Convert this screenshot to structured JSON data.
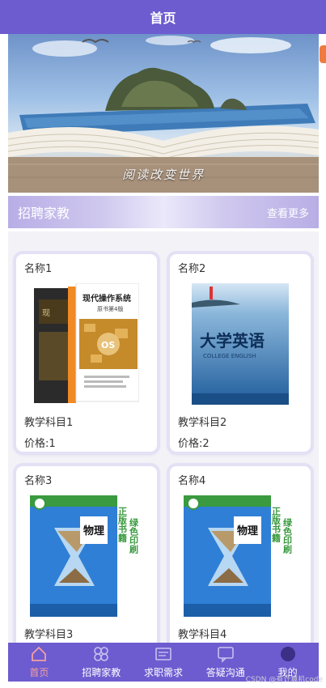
{
  "header": {
    "title": "首页"
  },
  "banner": {
    "slogan": "阅读改变世界"
  },
  "section": {
    "title": "招聘家教",
    "more_label": "查看更多"
  },
  "cards": [
    {
      "name": "名称1",
      "subject": "教学科目1",
      "price": "价格:1",
      "cover": "os-book"
    },
    {
      "name": "名称2",
      "subject": "教学科目2",
      "price": "价格:2",
      "cover": "english-book",
      "cover_title": "大学英语",
      "cover_subtitle": "COLLEGE ENGLISH"
    },
    {
      "name": "名称3",
      "subject": "教学科目3",
      "cover": "physics-book",
      "cover_title": "物理",
      "side_text": "正版书籍 绿色印刷"
    },
    {
      "name": "名称4",
      "subject": "教学科目4",
      "cover": "physics-book",
      "cover_title": "物理",
      "side_text": "正版书籍 绿色印刷"
    }
  ],
  "os_book": {
    "title": "现代操作系统",
    "subtitle": "原书第4版",
    "badge": "OS"
  },
  "nav": [
    {
      "label": "首页",
      "icon": "home-icon",
      "active": true
    },
    {
      "label": "招聘家教",
      "icon": "grid-icon",
      "active": false
    },
    {
      "label": "求职需求",
      "icon": "id-card-icon",
      "active": false
    },
    {
      "label": "答疑沟通",
      "icon": "chat-icon",
      "active": false
    },
    {
      "label": "我的",
      "icon": "user-icon",
      "active": false
    }
  ],
  "watermark": "CSDN @有计算机code",
  "colors": {
    "primary": "#6d5bd0",
    "active_nav": "#f2a0a0",
    "card_shadow": "#e4e0f5"
  }
}
